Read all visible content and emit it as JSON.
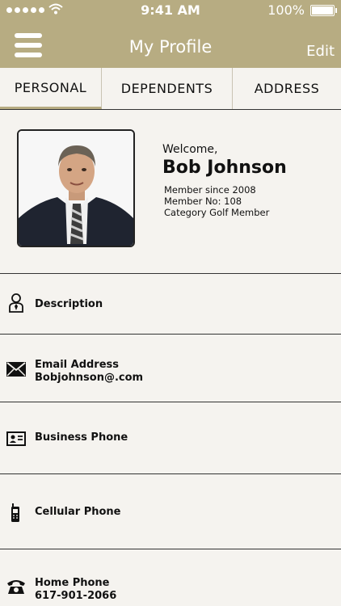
{
  "status_bar": {
    "time": "9:41 AM",
    "battery": "100%"
  },
  "header": {
    "title": "My Profile",
    "edit_label": "Edit"
  },
  "tabs": [
    {
      "label": "PERSONAL",
      "active": true
    },
    {
      "label": "DEPENDENTS",
      "active": false
    },
    {
      "label": "ADDRESS",
      "active": false
    }
  ],
  "profile": {
    "welcome": "Welcome,",
    "name": "Bob Johnson",
    "member_since": "Member since 2008",
    "member_no": "Member No: 108",
    "category": "Category Golf Member"
  },
  "fields": [
    {
      "label": "Description",
      "value": "",
      "icon": "person-tie-icon"
    },
    {
      "label": "Email Address",
      "value": "Bobjohnson@.com",
      "icon": "envelope-icon"
    },
    {
      "label": "Business Phone",
      "value": "",
      "icon": "id-card-icon"
    },
    {
      "label": "Cellular Phone",
      "value": "",
      "icon": "mobile-phone-icon"
    },
    {
      "label": "Home Phone",
      "value": "617-901-2066",
      "icon": "telephone-icon"
    }
  ],
  "colors": {
    "header_bg": "#b7ac82",
    "page_bg": "#f5f3ef",
    "divider": "#333333"
  }
}
